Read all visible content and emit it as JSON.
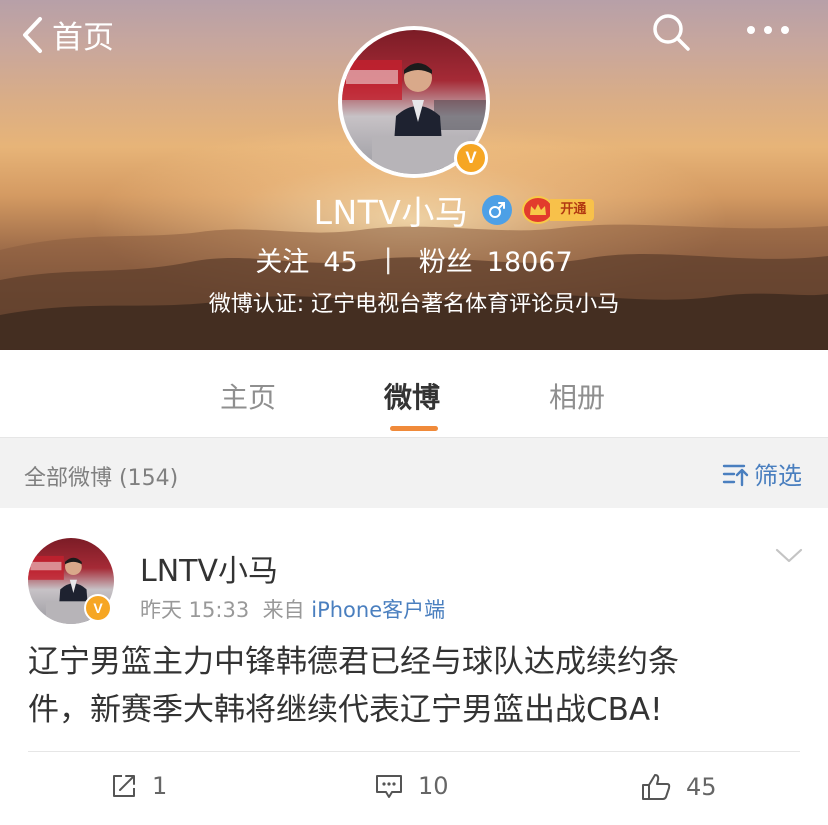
{
  "header": {
    "back_label": "首页",
    "profile_name": "LNTV小马",
    "vip_label": "开通",
    "following_label": "关注",
    "following_count": "45",
    "separator": "|",
    "followers_label": "粉丝",
    "followers_count": "18067",
    "verified_text": "微博认证: 辽宁电视台著名体育评论员小马",
    "verified_badge": "V"
  },
  "tabs": [
    {
      "label": "主页",
      "active": false
    },
    {
      "label": "微博",
      "active": true
    },
    {
      "label": "相册",
      "active": false
    }
  ],
  "filter": {
    "title": "全部微博 (154)",
    "button_label": "筛选"
  },
  "post": {
    "author": "LNTV小马",
    "time": "昨天 15:33",
    "from_label": "来自",
    "source": "iPhone客户端",
    "text_line1": "辽宁男篮主力中锋韩德君已经与球队达成续约条",
    "text_line2": "件，新赛季大韩将继续代表辽宁男篮出战CBA!",
    "verified_badge": "V",
    "repost_count": "1",
    "comment_count": "10",
    "like_count": "45"
  },
  "colors": {
    "accent_orange": "#f08a3a",
    "link_blue": "#4a7fbf",
    "verified_gold": "#f6a623",
    "gender_blue": "#4da0e6"
  },
  "icons": [
    "chevron-left-icon",
    "search-icon",
    "more-icon",
    "verified-icon",
    "gender-male-icon",
    "vip-crown-icon",
    "filter-icon",
    "chevron-down-icon",
    "repost-icon",
    "comment-icon",
    "like-icon"
  ]
}
